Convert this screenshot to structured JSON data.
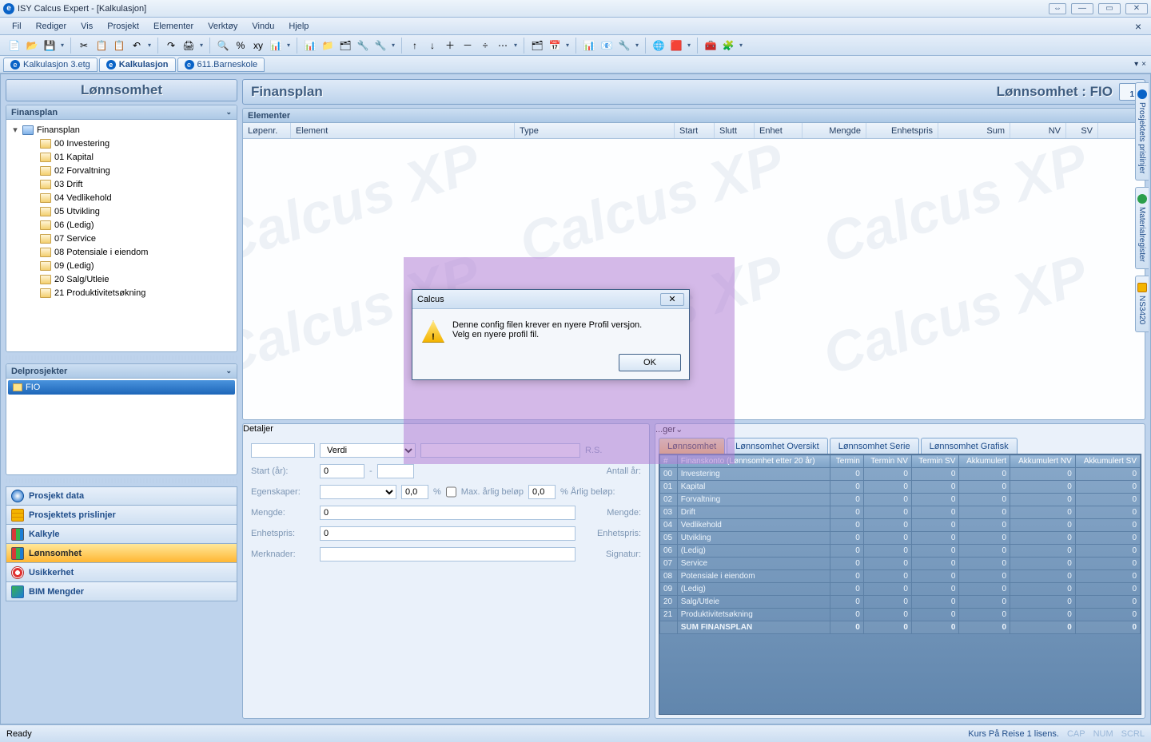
{
  "window": {
    "title": "ISY Calcus Expert - [Kalkulasjon]"
  },
  "menu": [
    "Fil",
    "Rediger",
    "Vis",
    "Prosjekt",
    "Elementer",
    "Verktøy",
    "Vindu",
    "Hjelp"
  ],
  "doctabs": [
    {
      "label": "Kalkulasjon 3.etg",
      "active": false
    },
    {
      "label": "Kalkulasjon",
      "active": true
    },
    {
      "label": "611.Barneskole",
      "active": false
    }
  ],
  "left": {
    "title": "Lønnsomhet",
    "panel_finansplan": "Finansplan",
    "tree_root": "Finansplan",
    "tree": [
      "00 Investering",
      "01 Kapital",
      "02 Forvaltning",
      "03 Drift",
      "04 Vedlikehold",
      "05 Utvikling",
      "06 (Ledig)",
      "07 Service",
      "08 Potensiale i eiendom",
      "09 (Ledig)",
      "20 Salg/Utleie",
      "21 Produktivitetsøkning"
    ],
    "panel_delprosjekter": "Delprosjekter",
    "fio": "FIO",
    "nav": [
      {
        "label": "Prosjekt data",
        "active": false
      },
      {
        "label": "Prosjektets prislinjer",
        "active": false
      },
      {
        "label": "Kalkyle",
        "active": false
      },
      {
        "label": "Lønnsomhet",
        "active": true
      },
      {
        "label": "Usikkerhet",
        "active": false
      },
      {
        "label": "BIM Mengder",
        "active": false
      }
    ]
  },
  "center": {
    "title": "Finansplan",
    "title_right": "Lønnsomhet : FIO",
    "pagebox": "1",
    "panel_elementer": "Elementer",
    "grid_cols": [
      "Løpenr.",
      "Element",
      "Type",
      "Start",
      "Slutt",
      "Enhet",
      "Mengde",
      "Enhetspris",
      "Sum",
      "NV",
      "SV"
    ],
    "watermark": "Calcus XP",
    "panel_detaljer": "Detaljer",
    "panel_right": "...ger",
    "det": {
      "verdi": "Verdi",
      "rs": "R.S.",
      "start_lbl": "Start (år):",
      "start_val": "0",
      "dash": "-",
      "antall_lbl": "Antall år:",
      "egensk_lbl": "Egenskaper:",
      "egensk_pct": "0,0",
      "pct": "%",
      "max_lbl": "Max. årlig beløp",
      "max_val": "0,0",
      "arlig_lbl": "% Årlig beløp:",
      "mengde_lbl": "Mengde:",
      "mengde_val": "0",
      "mengde2_lbl": "Mengde:",
      "enh_lbl": "Enhetspris:",
      "enh_val": "0",
      "enh2_lbl": "Enhetspris:",
      "merk_lbl": "Merknader:",
      "sign_lbl": "Signatur:"
    },
    "rtabs": [
      "Lønnsomhet",
      "Lønnsomhet Oversikt",
      "Lønnsomhet Serie",
      "Lønnsomhet Grafisk"
    ],
    "rtable_head": [
      "#",
      "Finanskonto (Lønnsomhet etter 20 år)",
      "Termin",
      "Termin NV",
      "Termin SV",
      "Akkumulert",
      "Akkumulert NV",
      "Akkumulert SV"
    ],
    "rtable_rows": [
      [
        "00",
        "Investering",
        "0",
        "0",
        "0",
        "0",
        "0",
        "0"
      ],
      [
        "01",
        "Kapital",
        "0",
        "0",
        "0",
        "0",
        "0",
        "0"
      ],
      [
        "02",
        "Forvaltning",
        "0",
        "0",
        "0",
        "0",
        "0",
        "0"
      ],
      [
        "03",
        "Drift",
        "0",
        "0",
        "0",
        "0",
        "0",
        "0"
      ],
      [
        "04",
        "Vedlikehold",
        "0",
        "0",
        "0",
        "0",
        "0",
        "0"
      ],
      [
        "05",
        "Utvikling",
        "0",
        "0",
        "0",
        "0",
        "0",
        "0"
      ],
      [
        "06",
        "(Ledig)",
        "0",
        "0",
        "0",
        "0",
        "0",
        "0"
      ],
      [
        "07",
        "Service",
        "0",
        "0",
        "0",
        "0",
        "0",
        "0"
      ],
      [
        "08",
        "Potensiale i eiendom",
        "0",
        "0",
        "0",
        "0",
        "0",
        "0"
      ],
      [
        "09",
        "(Ledig)",
        "0",
        "0",
        "0",
        "0",
        "0",
        "0"
      ],
      [
        "20",
        "Salg/Utleie",
        "0",
        "0",
        "0",
        "0",
        "0",
        "0"
      ],
      [
        "21",
        "Produktivitetsøkning",
        "0",
        "0",
        "0",
        "0",
        "0",
        "0"
      ],
      [
        "",
        "SUM FINANSPLAN",
        "0",
        "0",
        "0",
        "0",
        "0",
        "0"
      ]
    ]
  },
  "dock": [
    "Prosjektets prislinjer",
    "Materialregister",
    "NS3420"
  ],
  "status": {
    "left": "Ready",
    "right": "Kurs På Reise  1 lisens.",
    "caps": "CAP",
    "num": "NUM",
    "scrl": "SCRL"
  },
  "modal": {
    "title": "Calcus",
    "line1": "Denne config filen krever en nyere Profil versjon.",
    "line2": "Velg en nyere profil fil.",
    "ok": "OK"
  },
  "toolbar_icons": [
    "📄",
    "📂",
    "💾",
    "✂",
    "📋",
    "📋",
    "↶",
    "↷",
    "🖨",
    "🔍",
    "%",
    "xy",
    "📊",
    "📊",
    "📁",
    "🗂",
    "🔧",
    "🔧",
    "↑",
    "↓",
    "＋",
    "－",
    "÷",
    "⋯",
    "🗂",
    "📅",
    "📊",
    "📧",
    "🔧",
    "🌐",
    "🟥",
    "🧰",
    "🧩"
  ]
}
